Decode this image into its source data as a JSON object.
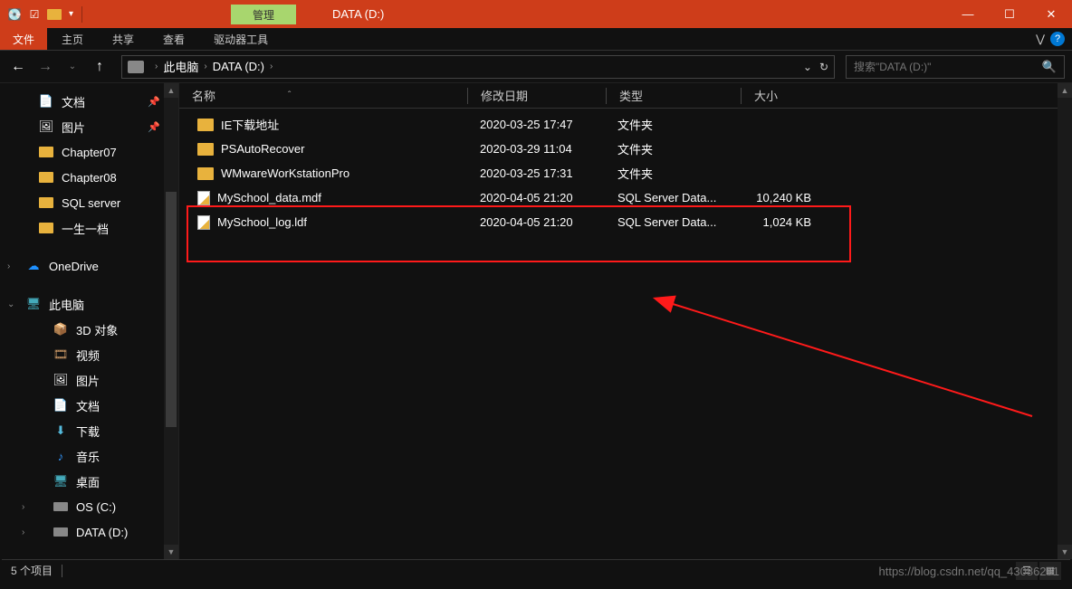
{
  "titlebar": {
    "manage_tab": "管理",
    "window_title": "DATA (D:)"
  },
  "ribbon": {
    "file": "文件",
    "tabs": [
      "主页",
      "共享",
      "查看",
      "驱动器工具"
    ]
  },
  "breadcrumb": {
    "parts": [
      "此电脑",
      "DATA (D:)"
    ]
  },
  "search": {
    "placeholder": "搜索\"DATA (D:)\""
  },
  "sidebar": {
    "quick": [
      {
        "label": "文档",
        "pinned": true,
        "icon": "doc"
      },
      {
        "label": "图片",
        "pinned": true,
        "icon": "pic"
      },
      {
        "label": "Chapter07",
        "pinned": false,
        "icon": "folder"
      },
      {
        "label": "Chapter08",
        "pinned": false,
        "icon": "folder"
      },
      {
        "label": "SQL server",
        "pinned": false,
        "icon": "folder"
      },
      {
        "label": "一生一档",
        "pinned": false,
        "icon": "folder"
      }
    ],
    "onedrive": "OneDrive",
    "thispc": "此电脑",
    "pc_children": [
      {
        "label": "3D 对象",
        "icon": "3d"
      },
      {
        "label": "视频",
        "icon": "video"
      },
      {
        "label": "图片",
        "icon": "pic"
      },
      {
        "label": "文档",
        "icon": "doc"
      },
      {
        "label": "下载",
        "icon": "down"
      },
      {
        "label": "音乐",
        "icon": "music"
      },
      {
        "label": "桌面",
        "icon": "desktop"
      },
      {
        "label": "OS (C:)",
        "icon": "drive"
      },
      {
        "label": "DATA (D:)",
        "icon": "drive"
      }
    ]
  },
  "columns": {
    "name": "名称",
    "date": "修改日期",
    "type": "类型",
    "size": "大小"
  },
  "files": [
    {
      "name": "IE下载地址",
      "date": "2020-03-25 17:47",
      "type": "文件夹",
      "size": "",
      "icon": "folder"
    },
    {
      "name": "PSAutoRecover",
      "date": "2020-03-29 11:04",
      "type": "文件夹",
      "size": "",
      "icon": "folder"
    },
    {
      "name": "WMwareWorKstationPro",
      "date": "2020-03-25 17:31",
      "type": "文件夹",
      "size": "",
      "icon": "folder"
    },
    {
      "name": "MySchool_data.mdf",
      "date": "2020-04-05 21:20",
      "type": "SQL Server Data...",
      "size": "10,240 KB",
      "icon": "file"
    },
    {
      "name": "MySchool_log.ldf",
      "date": "2020-04-05 21:20",
      "type": "SQL Server Data...",
      "size": "1,024 KB",
      "icon": "file"
    }
  ],
  "status": {
    "count": "5 个项目"
  },
  "watermark": "https://blog.csdn.net/qq_43086251"
}
